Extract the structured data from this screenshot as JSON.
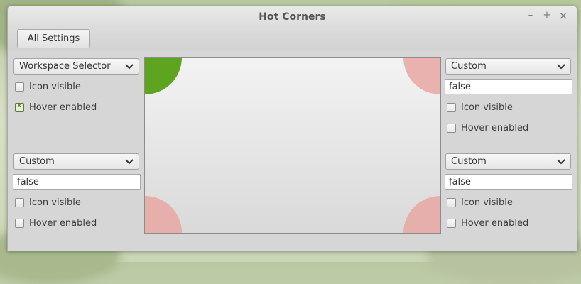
{
  "window": {
    "title": "Hot Corners",
    "controls": {
      "minimize": "–",
      "maximize": "+",
      "close": "×"
    }
  },
  "toolbar": {
    "all_settings_label": "All Settings"
  },
  "corners": {
    "top_left": {
      "action": "Workspace Selector",
      "icon_visible_label": "Icon visible",
      "hover_enabled_label": "Hover enabled",
      "icon_visible": false,
      "hover_enabled": true,
      "active": true
    },
    "top_right": {
      "action": "Custom",
      "command": "false",
      "icon_visible_label": "Icon visible",
      "hover_enabled_label": "Hover enabled",
      "icon_visible": false,
      "hover_enabled": false,
      "active": false
    },
    "bottom_left": {
      "action": "Custom",
      "command": "false",
      "icon_visible_label": "Icon visible",
      "hover_enabled_label": "Hover enabled",
      "icon_visible": false,
      "hover_enabled": false,
      "active": false
    },
    "bottom_right": {
      "action": "Custom",
      "command": "false",
      "icon_visible_label": "Icon visible",
      "hover_enabled_label": "Hover enabled",
      "icon_visible": false,
      "hover_enabled": false,
      "active": false
    }
  },
  "colors": {
    "corner_active": "#5ea420",
    "corner_inactive": "#e7a7a3"
  },
  "icons": {
    "dropdown": "chevron-down-icon"
  }
}
